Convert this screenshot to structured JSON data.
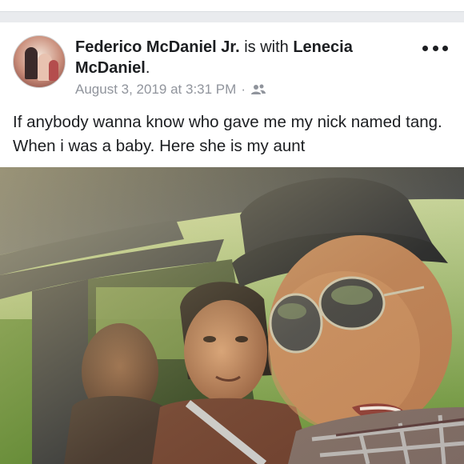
{
  "post": {
    "author": "Federico McDaniel Jr.",
    "with_text": " is with ",
    "tagged": "Lenecia McDaniel",
    "tagged_suffix": ".",
    "timestamp": "August 3, 2019 at 3:31 PM",
    "separator": "·",
    "audience_icon": "friends-icon",
    "more_icon": "more-options-icon",
    "text": "If anybody wanna know who gave me my nick named tang. When i was a baby. Here she is my aunt"
  }
}
